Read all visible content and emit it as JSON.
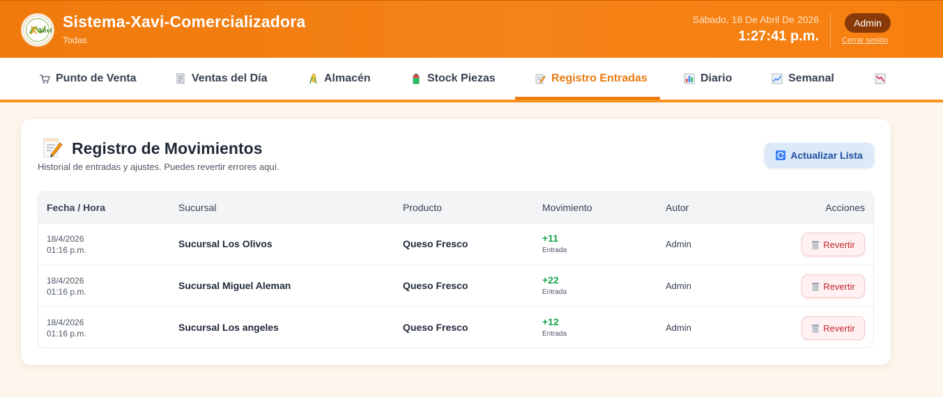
{
  "header": {
    "title": "Sistema-Xavi-Comercializadora",
    "subtitle": "Todas",
    "date": "Sábado, 18 De Abril De 2026",
    "time": "1:27:41 p.m.",
    "user_badge": "Admin",
    "logout_label": "Cerrar sesión",
    "logo_text": "Xavi"
  },
  "nav": {
    "tabs": [
      {
        "label": "Punto de Venta",
        "icon": "cart-icon"
      },
      {
        "label": "Ventas del Día",
        "icon": "receipt-icon"
      },
      {
        "label": "Almacén",
        "icon": "corn-icon"
      },
      {
        "label": "Stock Piezas",
        "icon": "battery-icon"
      },
      {
        "label": "Registro Entradas",
        "icon": "memo-icon",
        "active": true
      },
      {
        "label": "Diario",
        "icon": "bar-chart-icon"
      },
      {
        "label": "Semanal",
        "icon": "trend-up-icon"
      },
      {
        "label": "",
        "icon": "trend-down-icon"
      }
    ]
  },
  "panel": {
    "title": "Registro de Movimientos",
    "subtitle": "Historial de entradas y ajustes. Puedes revertir errores aquí.",
    "refresh_label": "Actualizar Lista"
  },
  "table": {
    "headers": {
      "date": "Fecha / Hora",
      "branch": "Sucursal",
      "product": "Producto",
      "movement": "Movimiento",
      "author": "Autor",
      "actions": "Acciones"
    },
    "rows": [
      {
        "date": "18/4/2026",
        "time": "01:16 p.m.",
        "branch": "Sucursal Los Olivos",
        "product": "Queso Fresco",
        "qty": "+11",
        "type": "Entrada",
        "author": "Admin",
        "action": "Revertir"
      },
      {
        "date": "18/4/2026",
        "time": "01:16 p.m.",
        "branch": "Sucursal Miguel Aleman",
        "product": "Queso Fresco",
        "qty": "+22",
        "type": "Entrada",
        "author": "Admin",
        "action": "Revertir"
      },
      {
        "date": "18/4/2026",
        "time": "01:16 p.m.",
        "branch": "Sucursal Los angeles",
        "product": "Queso Fresco",
        "qty": "+12",
        "type": "Entrada",
        "author": "Admin",
        "action": "Revertir"
      }
    ]
  },
  "colors": {
    "header_orange": "#f58318",
    "active_tab": "#ea7a0f",
    "positive": "#16a34a",
    "danger": "#c0262d",
    "refresh_bg": "#dbe9f8"
  }
}
